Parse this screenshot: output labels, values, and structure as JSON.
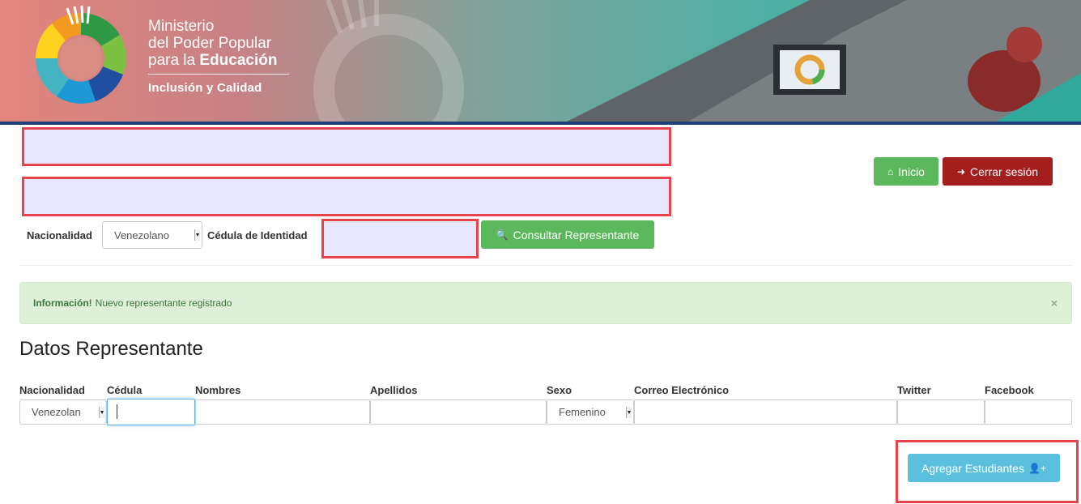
{
  "header": {
    "logo_line1": "Ministerio",
    "logo_line2": "del Poder Popular",
    "logo_line3_prefix": "para la ",
    "logo_line3_bold": "Educación",
    "logo_subtitle": "Inclusión y Calidad"
  },
  "nav": {
    "home_label": "Inicio",
    "home_icon": "home-icon",
    "logout_label": "Cerrar sesión",
    "logout_icon": "sign-out-icon"
  },
  "search": {
    "nationality_label": "Nacionalidad",
    "nationality_value": "Venezolano",
    "id_label": "Cédula de Identidad",
    "id_value": "",
    "button_label": "Consultar Representante",
    "button_icon": "search-icon"
  },
  "alert": {
    "title": "Información!",
    "message": "Nuevo representante registrado",
    "close": "×"
  },
  "form": {
    "title": "Datos Representante",
    "columns": [
      "Nacionalidad",
      "Cédula",
      "Nombres",
      "Apellidos",
      "Sexo",
      "Correo Electrónico",
      "Twitter",
      "Facebook"
    ],
    "nationality_value": "Venezolan",
    "cedula_value": "",
    "nombres_value": "",
    "apellidos_value": "",
    "sexo_value": "Femenino",
    "correo_value": "",
    "twitter_value": "",
    "facebook_value": ""
  },
  "actions": {
    "add_students_label": "Agregar Estudiantes",
    "add_students_icon": "add-user-icon"
  },
  "colors": {
    "success": "#5cb85c",
    "danger": "#a51e1e",
    "info": "#5bc0de",
    "highlight_border": "#e8424a",
    "redacted_fill": "#e6e6ff"
  }
}
